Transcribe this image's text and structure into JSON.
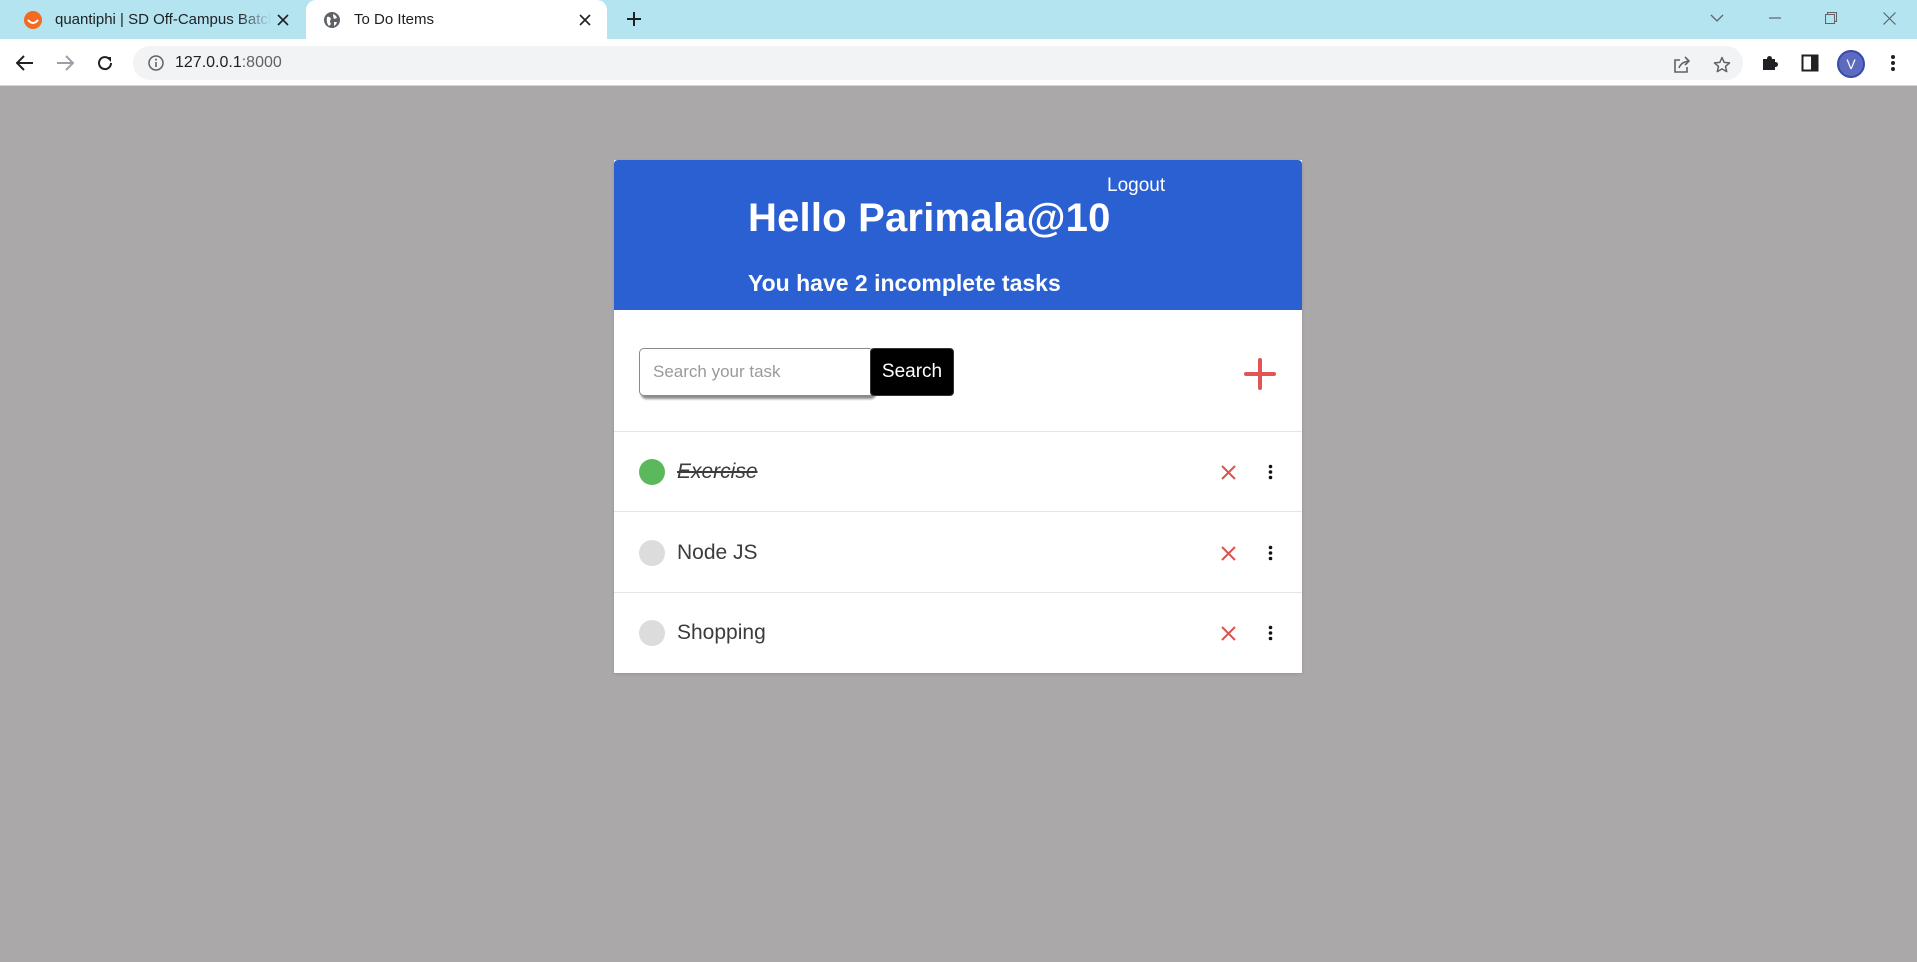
{
  "browser": {
    "tabs": [
      {
        "title": "quantiphi | SD Off-Campus Batch",
        "active": false,
        "favicon": "quantiphi-logo-icon"
      },
      {
        "title": "To Do Items",
        "active": true,
        "favicon": "globe-icon"
      }
    ],
    "address": {
      "host": "127.0.0.1",
      "port": ":8000"
    },
    "profile_initial": "V"
  },
  "app": {
    "logout_label": "Logout",
    "greeting": "Hello Parimala@10",
    "summary": "You have 2 incomplete tasks",
    "search": {
      "placeholder": "Search your task",
      "value": "",
      "button_label": "Search"
    },
    "colors": {
      "header": "#2a60d1",
      "add": "#e05555",
      "delete": "#d9534f",
      "done": "#5cb85c",
      "pending": "#dcdcdc"
    },
    "tasks": [
      {
        "label": "Exercise",
        "completed": true
      },
      {
        "label": "Node JS",
        "completed": false
      },
      {
        "label": "Shopping",
        "completed": false
      }
    ]
  }
}
